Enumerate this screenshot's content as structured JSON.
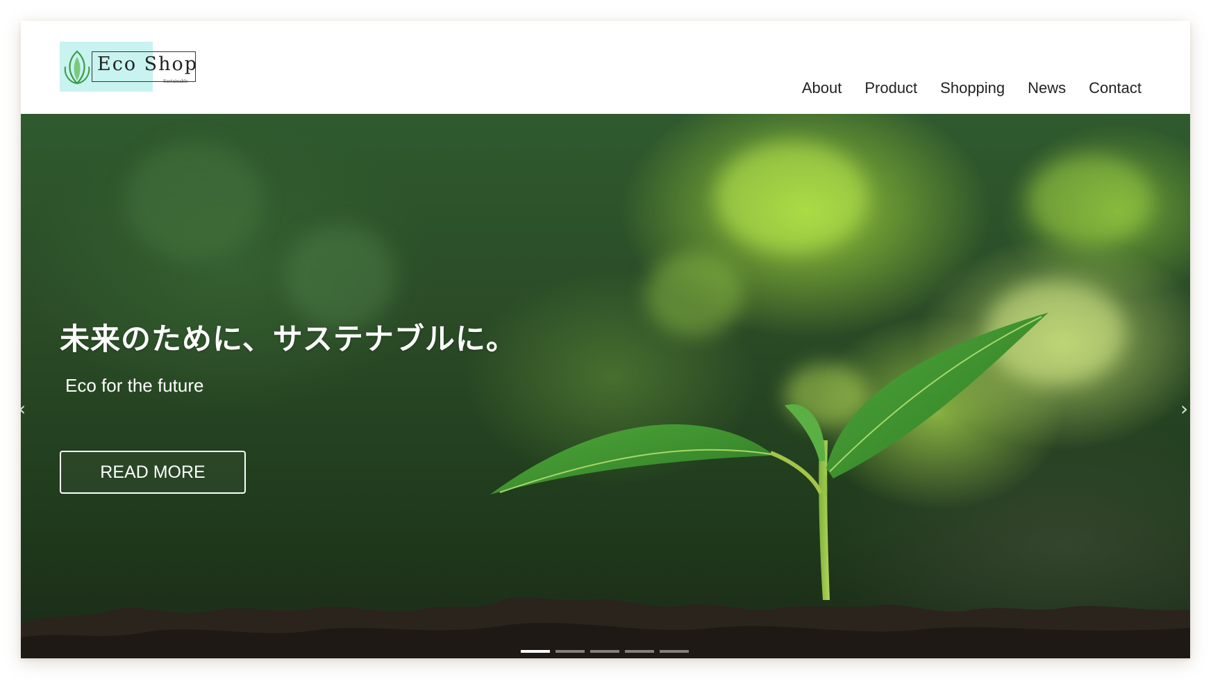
{
  "header": {
    "logo": {
      "name": "Eco Shop",
      "tagline": "Sustainable",
      "icon": "leaf-icon"
    },
    "nav": [
      {
        "label": "About"
      },
      {
        "label": "Product"
      },
      {
        "label": "Shopping"
      },
      {
        "label": "News"
      },
      {
        "label": "Contact"
      }
    ]
  },
  "hero": {
    "headline": "未来のために、サステナブルに。",
    "subline": "Eco for the future",
    "cta_label": "READ MORE",
    "prev_icon": "chevron-left-icon",
    "next_icon": "chevron-right-icon",
    "prev_glyph": "‹",
    "next_glyph": "›",
    "slides_total": 5,
    "active_slide": 1
  },
  "colors": {
    "logo_highlight": "#c8f3f0",
    "nav_text": "#222222",
    "hero_text": "#ffffff"
  }
}
